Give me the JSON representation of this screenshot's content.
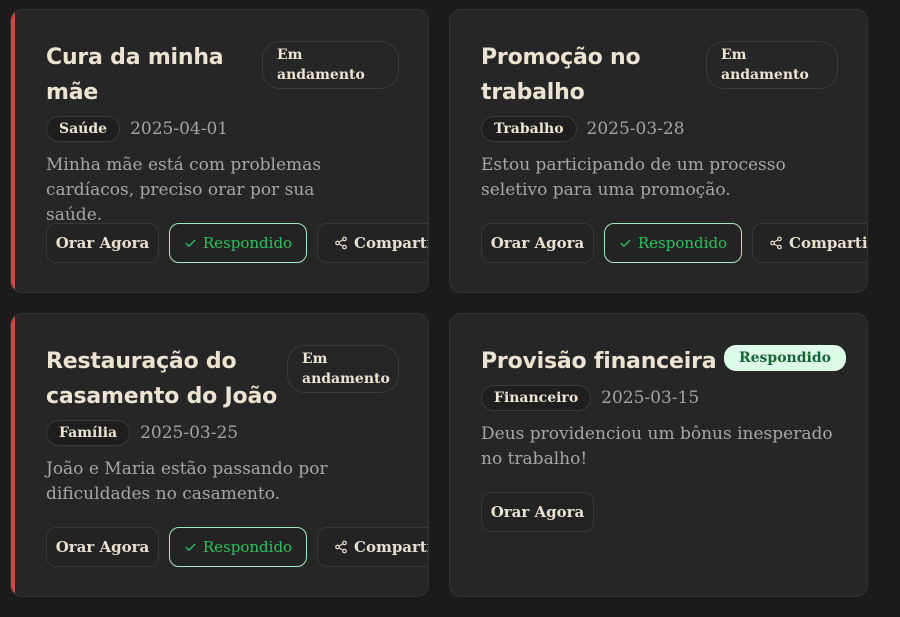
{
  "accent_colors": {
    "urgent_bar": "#d64545",
    "answered_text": "#22c55e",
    "answered_badge_bg": "#dcfce7",
    "answered_badge_text": "#166534"
  },
  "cards": [
    {
      "title": "Cura da minha mãe",
      "status": "Em andamento",
      "category": "Saúde",
      "date": "2025-04-01",
      "description": "Minha mãe está com problemas cardíacos, preciso orar por sua saúde.",
      "actions": {
        "pray": "Orar Agora",
        "answered": "Respondido",
        "share": "Compartilhar"
      }
    },
    {
      "title": "Promoção no trabalho",
      "status": "Em andamento",
      "category": "Trabalho",
      "date": "2025-03-28",
      "description": "Estou participando de um processo seletivo para uma promoção.",
      "actions": {
        "pray": "Orar Agora",
        "answered": "Respondido",
        "share": "Compartilhar"
      }
    },
    {
      "title": "Restauração do casamento do João",
      "status": "Em andamento",
      "category": "Família",
      "date": "2025-03-25",
      "description": "João e Maria estão passando por dificuldades no casamento.",
      "actions": {
        "pray": "Orar Agora",
        "answered": "Respondido",
        "share": "Compartilhar"
      }
    },
    {
      "title": "Provisão financeira",
      "status": "Respondido",
      "category": "Financeiro",
      "date": "2025-03-15",
      "description": "Deus providenciou um bônus inesperado no trabalho!",
      "actions": {
        "pray": "Orar Agora"
      }
    }
  ],
  "icons": {
    "answered": "check-icon",
    "share": "share-icon"
  }
}
